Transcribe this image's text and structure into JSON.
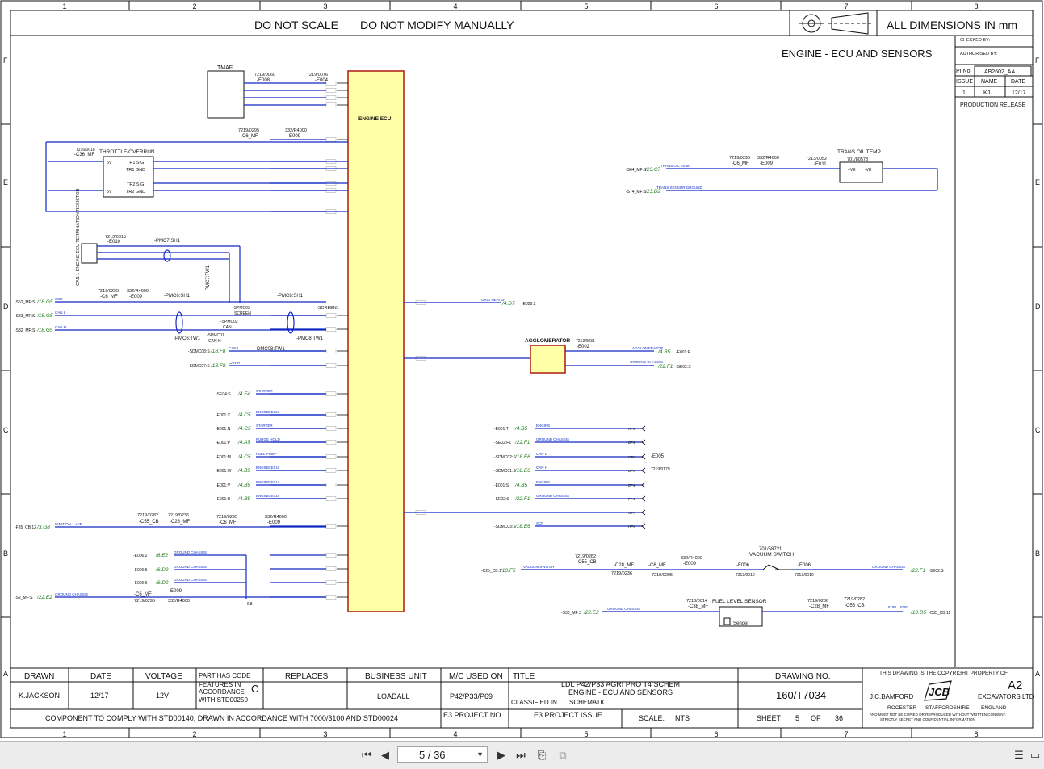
{
  "header": {
    "do_not_scale": "DO NOT SCALE",
    "do_not_modify": "DO NOT MODIFY MANUALLY",
    "dimensions": "ALL DIMENSIONS IN mm",
    "sheet_title": "ENGINE - ECU AND SENSORS"
  },
  "grid": {
    "columns": [
      "1",
      "2",
      "3",
      "4",
      "5",
      "6",
      "7",
      "8"
    ],
    "rows": [
      "F",
      "E",
      "D",
      "C",
      "B",
      "A"
    ]
  },
  "approval": {
    "checked_by": "CHECKED BY:",
    "authorised_by": "AUTHORISED BY:",
    "pi_no_label": "PI No",
    "pi_no": "AB2602_AA",
    "issue_label": "ISSUE",
    "name_label": "NAME",
    "date_label": "DATE",
    "issue": "1",
    "name": "KJ.",
    "date": "12/17",
    "release": "PRODUCTION RELEASE"
  },
  "components": {
    "ecu": "ENGINE ECU",
    "tmaf": "TMAF",
    "throttle": "THROTTLE/OVERRUN",
    "throttle_conn": "-C36_MF",
    "throttle_conn_pn": "7216/0018",
    "tr1_sig": "TR1 SIG",
    "tr1_gnd": "TR1 GND",
    "tr2_sig": "TR2 SIG",
    "tr2_gnd": "TR2 GND",
    "v5": "5V",
    "can_res": "CAN 1 ENGINE ECU TERMINATION RESISTOR",
    "can_res_pn": "7213/0015",
    "can_res_ref": "-E010",
    "trans_oil": "TRANS OIL TEMP",
    "trans_oil_pn": "701/80578",
    "trans_oil_ref": "-E011",
    "trans_oil_conn_pn": "7213/0052",
    "agglomerator": "AGGLOMERATOR",
    "agg_pn": "7213/0031",
    "agg_ref": "-E002",
    "vacuum": "VACUUM SWITCH",
    "vacuum_pn": "701/58721",
    "fuel_level": "FUEL LEVEL SENSOR",
    "sender": "Sender",
    "e005": "-E005",
    "e005_pn": "7219/0179",
    "e008": "-E008",
    "e008_pn": "7219/0060",
    "e004": "-E004",
    "e004_pn": "7219/0076"
  },
  "refs": {
    "c6": "-C6_MF",
    "c6_pn": "7219/0295",
    "e009": "-E009",
    "e009_pn": "332/R4000",
    "c28": "-C28_MF",
    "c28_pn": "7219/0236",
    "c55": "-C55_CB",
    "c55_pn": "7219/0282",
    "pmc7_sh1": "-PMC7:SH1",
    "pmc7_tw1": "-PMC7:TW1",
    "pmc6_sh1": "-PMC6:SH1",
    "pmc6_tw1": "-PMC6:TW1",
    "pmc8_sh1": "-PMC8:SH1",
    "pmc8_tw1": "-PMC8:TW1",
    "screen1": "-SCREEN1",
    "spmc03": "-SPMC03",
    "screen": "SCREEN",
    "spmc02": "-SPMC02",
    "can_l": "CAN L",
    "spmc01": "-SPMC01",
    "can_h": "CAN H",
    "dmc08": "-DMC08:TW1",
    "s8": "-S8",
    "e006": "-E006",
    "e006_pn": "7213/0010",
    "c38": "-C38_MF",
    "c38_pn": "7213/0014"
  },
  "left_signals": [
    {
      "ref": "-S52_MF:S",
      "dest": "/18.G5",
      "label": "SCR"
    },
    {
      "ref": "-S33_MF:S",
      "dest": "/18.G5",
      "label": "CAN L"
    },
    {
      "ref": "-S32_MF:S",
      "dest": "/18.G5",
      "label": "CAN H"
    },
    {
      "ref": "-SDMC08:S",
      "dest": "/18.F8",
      "label": "CAN L"
    },
    {
      "ref": "-SDMC07:S",
      "dest": "/18.F8",
      "label": "CAN H"
    },
    {
      "ref": "-SE04:S",
      "dest": "/4.F4",
      "label": "STARTER"
    },
    {
      "ref": "-E001:X",
      "dest": "/4.C5",
      "label": "ENGINE ECU"
    },
    {
      "ref": "-E001:N",
      "dest": "/4.C5",
      "label": "STARTER"
    },
    {
      "ref": "-E001:P",
      "dest": "/4.A5",
      "label": "PURGE HOLD"
    },
    {
      "ref": "-E001:M",
      "dest": "/4.C5",
      "label": "FUEL PUMP"
    },
    {
      "ref": "-E001:W",
      "dest": "/4.B5",
      "label": "ENGINE ECU"
    },
    {
      "ref": "-E001:V",
      "dest": "/4.B5",
      "label": "ENGINE ECU"
    },
    {
      "ref": "-E001:U",
      "dest": "/4.B5",
      "label": "ENGINE ECU"
    },
    {
      "ref": "-F85_CB:12",
      "dest": "/3.G8",
      "label": "IGNITION 1 +VE"
    },
    {
      "ref": "-E006:2",
      "dest": "/6.E2",
      "label": "GROUND CHASSIS"
    },
    {
      "ref": "-E006:2",
      "dest": "/6.E2",
      "label": "GROUND CHASSIS"
    },
    {
      "ref": "-E006:5",
      "dest": "/6.D2",
      "label": "GROUND CHASSIS"
    },
    {
      "ref": "-E006:6",
      "dest": "/6.D2",
      "label": "GROUND CHASSIS"
    },
    {
      "ref": "-S2_MF:S",
      "dest": "/22.E2",
      "label": "GROUND CHASSIS"
    }
  ],
  "right_signals": [
    {
      "ref": "-E001:T",
      "dest": "/4.B5",
      "label": "ENGINE",
      "pin": "AP4"
    },
    {
      "ref": "-SE02:F1",
      "dest": "/22.F1",
      "label": "GROUND CHASSIS",
      "pin": "BP4"
    },
    {
      "ref": "-SDMC02:S",
      "dest": "/18.E6",
      "label": "CAN L",
      "pin": "CP4"
    },
    {
      "ref": "-SDMC01:S",
      "dest": "/18.E6",
      "label": "CAN H",
      "pin": "DP4"
    },
    {
      "ref": "-E001:S",
      "dest": "/4.B5",
      "label": "ENGINE",
      "pin": "EP4"
    },
    {
      "ref": "-SE02:S",
      "dest": "/22.F1",
      "label": "GROUND CHASSIS",
      "pin": "FP4"
    },
    {
      "ref": "",
      "dest": "",
      "label": "",
      "pin": "GP4"
    },
    {
      "ref": "-SDMC03:S",
      "dest": "/18.E6",
      "label": "SCR",
      "pin": "HP4"
    }
  ],
  "misc_signals": {
    "s64": "-S64_MF:S",
    "s64_dest": "/23.C7",
    "s64_label": "TRANS OIL TEMP",
    "s74": "-S74_MF:S",
    "s74_dest": "/23.D2",
    "s74_label": "TRANS SENSOR GROUND",
    "e028": "-E028:2",
    "e028_dest": "/4.D7",
    "e028_label": "GRID HEATER",
    "e001f": "-E001:F",
    "e001f_dest": "/4.B5",
    "e001f_label": "AGGLOMERATOR",
    "se02s": "-SE02:S",
    "se02s_dest": "/22.F1",
    "se02s_label": "GROUND CHASSIS",
    "c25": "-C25_CB:1",
    "c25_dest": "/10.F5",
    "c25_label": "VACUUM SWITCH",
    "vac_dest": "/22.F1",
    "vac_ref": "-SE02:S",
    "vac_label": "GROUND CHASSIS",
    "s30": "-S30_MF:S",
    "s30_dest": "/22.E2",
    "s30_label": "GROUND CHASSIS",
    "c35": "-C35_CB:11",
    "c35_dest": "/10.D5",
    "c35_label": "FUEL LEVEL",
    "ve_plus": "+VE",
    "ve_minus": "-VE"
  },
  "title_block": {
    "drawn_label": "DRAWN",
    "drawn": "K.JACKSON",
    "date_label": "DATE",
    "date": "12/17",
    "voltage_label": "VOLTAGE",
    "voltage": "12V",
    "part_code_1": "PART HAS CODE",
    "part_code_2": "FEATURES IN",
    "part_code_3": "ACCORDANCE",
    "part_code_4": "WITH STD00250",
    "part_code_letter": "C",
    "replaces_label": "REPLACES",
    "business_label": "BUSINESS UNIT",
    "business": "LOADALL",
    "mc_label": "M/C USED ON",
    "mc": "P42/P33/P69",
    "title_label": "TITLE",
    "title_1": "LDL P42/P33 AGRI PRO T4 SCHEM",
    "title_2": "ENGINE - ECU AND SENSORS",
    "classified_label": "CLASSIFIED IN",
    "classified": "SCHEMATIC",
    "drawing_no_label": "DRAWING NO.",
    "drawing_no": "160/T7034",
    "copyright": "THIS DRAWING IS THE COPYRIGHT PROPERTY OF",
    "size": "A2",
    "company_1": "J.C.BAMFORD",
    "company_2": "EXCAVATORS LTD",
    "loc_1": "ROCESTER",
    "loc_2": "STAFFORDSHIRE",
    "loc_3": "ENGLAND",
    "legal_1": "AND MUST NOT BE COPIED OR REPRODUCED WITHOUT WRITTEN CONSENT.",
    "legal_2": "STRICTLY SECRET AND CONFIDENTIAL INFORMATION",
    "logo": "JCB",
    "comply": "COMPONENT TO COMPLY WITH STD00140, DRAWN IN ACCORDANCE WITH 7000/3100 AND STD00024",
    "e3_label": "E3 PROJECT NO.",
    "e3_issue_label": "E3 PROJECT ISSUE",
    "scale_label": "SCALE:",
    "scale": "NTS",
    "sheet_label": "SHEET",
    "sheet": "5",
    "of_label": "OF",
    "sheet_total": "36"
  },
  "viewer": {
    "page_display": "5 / 36",
    "first_icon": "first-page-icon",
    "prev_icon": "prev-page-icon",
    "next_icon": "next-page-icon",
    "last_icon": "last-page-icon"
  },
  "colors": {
    "ecu_fill": "#ffffa8",
    "ecu_border": "#b0281c",
    "wire": "#1028c8",
    "dest_text": "#1a7a1a"
  }
}
